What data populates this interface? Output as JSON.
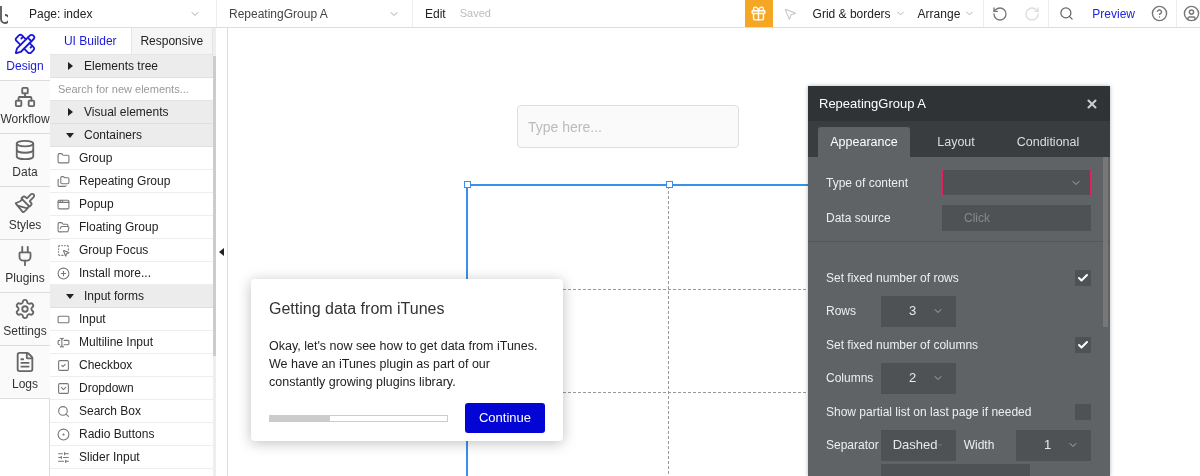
{
  "topbar": {
    "page_selector": "Page: index",
    "element_selector": "RepeatingGroup A",
    "edit_menu": "Edit",
    "save_status": "Saved",
    "grid_menu": "Grid & borders",
    "arrange_menu": "Arrange",
    "preview_link": "Preview"
  },
  "nav": [
    {
      "label": "Design",
      "selected": true
    },
    {
      "label": "Workflow",
      "selected": false
    },
    {
      "label": "Data",
      "selected": false
    },
    {
      "label": "Styles",
      "selected": false
    },
    {
      "label": "Plugins",
      "selected": false
    },
    {
      "label": "Settings",
      "selected": false
    },
    {
      "label": "Logs",
      "selected": false
    }
  ],
  "panel_tabs": [
    {
      "label": "UI Builder",
      "selected": true
    },
    {
      "label": "Responsive",
      "selected": false
    }
  ],
  "element_sections": [
    {
      "kind": "section",
      "title": "Elements tree",
      "expanded": false
    },
    {
      "kind": "search",
      "placeholder": "Search for new elements..."
    },
    {
      "kind": "section",
      "title": "Visual elements",
      "expanded": false
    },
    {
      "kind": "section",
      "title": "Containers",
      "expanded": true,
      "items": [
        "Group",
        "Repeating Group",
        "Popup",
        "Floating Group",
        "Group Focus",
        "Install more..."
      ]
    },
    {
      "kind": "section",
      "title": "Input forms",
      "expanded": true,
      "items": [
        "Input",
        "Multiline Input",
        "Checkbox",
        "Dropdown",
        "Search Box",
        "Radio Buttons",
        "Slider Input"
      ]
    }
  ],
  "canvas": {
    "input": {
      "placeholder": "Type here..."
    }
  },
  "tutorial": {
    "title": "Getting data from iTunes",
    "body": "Okay, let's now see how to get data from iTunes. We have an iTunes plugin as part of our constantly growing plugins library.",
    "progress": {
      "level": 0.34
    },
    "button": "Continue"
  },
  "properties": {
    "title": "RepeatingGroup A",
    "tabs": [
      {
        "label": "Appearance",
        "selected": true
      },
      {
        "label": "Layout",
        "selected": false
      },
      {
        "label": "Conditional",
        "selected": false
      }
    ],
    "groups": [
      [
        {
          "kind": "dropdown",
          "label": "Type of content",
          "invalid": true
        },
        {
          "kind": "text_field",
          "label": "Data source",
          "placeholder": "Click"
        }
      ],
      [
        {
          "kind": "checkbox",
          "label": "Set fixed number of rows",
          "checked": true
        },
        {
          "kind": "select",
          "label": "Rows",
          "value": "3"
        },
        {
          "kind": "checkbox",
          "label": "Set fixed number of columns",
          "checked": true
        },
        {
          "kind": "select",
          "label": "Columns",
          "value": "2"
        },
        {
          "kind": "checkbox",
          "label": "Show partial list on last page if needed",
          "checked": false
        },
        {
          "kind": "pair",
          "label": "Separator",
          "value": "Dashed",
          "label2": "Width",
          "value2": "1"
        },
        {
          "kind": "select"
        }
      ]
    ]
  }
}
